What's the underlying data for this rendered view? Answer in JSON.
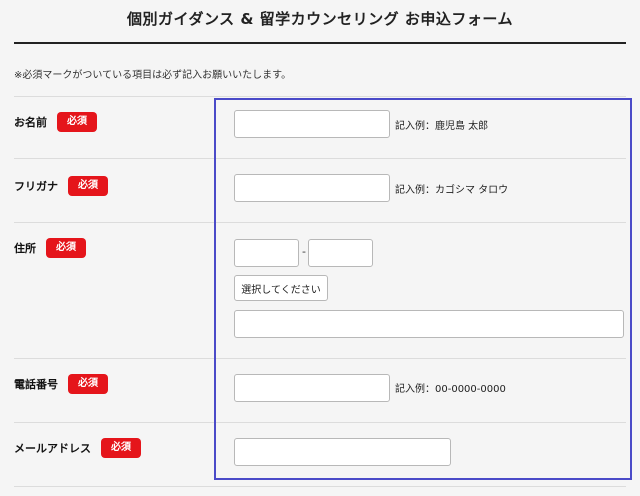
{
  "page": {
    "title": "個別ガイダンス & 留学カウンセリング お申込フォーム",
    "note": "※必須マークがついている項目は必ず記入お願いいたします。"
  },
  "required_badge": "必須",
  "form": {
    "name": {
      "label": "お名前",
      "value": "",
      "example": "記入例：鹿児島 太郎"
    },
    "kana": {
      "label": "フリガナ",
      "value": "",
      "example": "記入例：カゴシマ タロウ"
    },
    "address": {
      "label": "住所",
      "postal_first": "",
      "postal_separator": "-",
      "postal_second": "",
      "select_label": "選択してください",
      "street": ""
    },
    "phone": {
      "label": "電話番号",
      "value": "",
      "example": "記入例：00-0000-0000"
    },
    "email": {
      "label": "メールアドレス",
      "value": ""
    }
  },
  "colors": {
    "badge": "#e5151b",
    "highlight_border": "#4a4ac8",
    "background": "#f5f5f5"
  }
}
